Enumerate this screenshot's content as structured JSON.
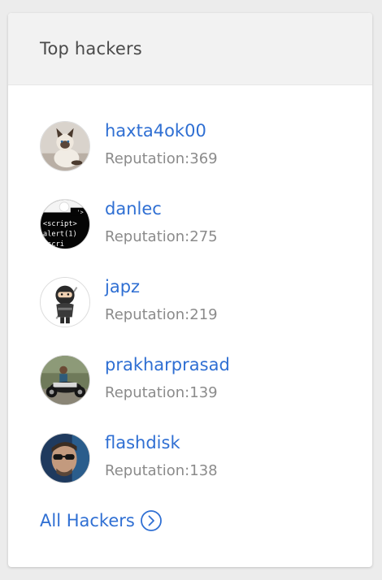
{
  "card": {
    "title": "Top hackers"
  },
  "hackers": [
    {
      "name": "haxta4ok00",
      "reputation": "Reputation:369",
      "avatar": "cat-avatar-icon"
    },
    {
      "name": "danlec",
      "reputation": "Reputation:275",
      "avatar": "script-code-avatar-icon",
      "avatar_text": [
        "'>",
        "<script>",
        "alert(1)",
        "<scri"
      ]
    },
    {
      "name": "japz",
      "reputation": "Reputation:219",
      "avatar": "ninja-avatar-icon"
    },
    {
      "name": "prakharprasad",
      "reputation": "Reputation:139",
      "avatar": "motorcycle-photo-avatar-icon"
    },
    {
      "name": "flashdisk",
      "reputation": "Reputation:138",
      "avatar": "sunglasses-portrait-avatar-icon"
    }
  ],
  "footer": {
    "all_label": "All Hackers",
    "icon": "chevron-right-circle-icon"
  },
  "colors": {
    "link": "#2f6fd3",
    "muted": "#8b8b8b",
    "header_bg": "#f2f2f2",
    "page_bg": "#ececec"
  }
}
